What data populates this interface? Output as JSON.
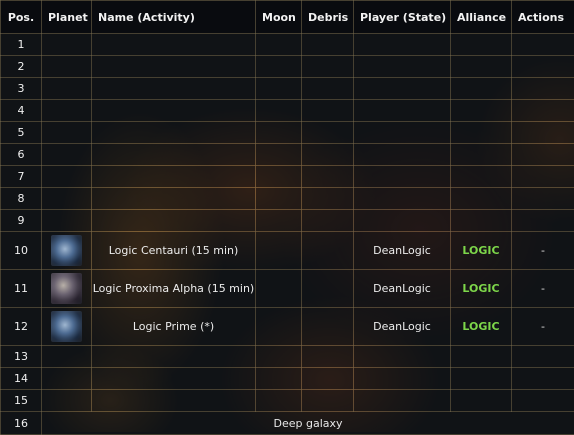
{
  "headers": {
    "pos": "Pos.",
    "planet": "Planet",
    "name": "Name (Activity)",
    "moon": "Moon",
    "debris": "Debris",
    "player": "Player (State)",
    "alliance": "Alliance",
    "actions": "Actions"
  },
  "rows": [
    {
      "pos": "1"
    },
    {
      "pos": "2"
    },
    {
      "pos": "3"
    },
    {
      "pos": "4"
    },
    {
      "pos": "5"
    },
    {
      "pos": "6"
    },
    {
      "pos": "7"
    },
    {
      "pos": "8"
    },
    {
      "pos": "9"
    },
    {
      "pos": "10",
      "planet_icon": "planet-blue-icon",
      "name": "Logic Centauri (15 min)",
      "player": "DeanLogic",
      "alliance": "LOGIC",
      "actions": "-"
    },
    {
      "pos": "11",
      "planet_icon": "planet-grey-icon",
      "name": "Logic Proxima Alpha (15 min)",
      "player": "DeanLogic",
      "alliance": "LOGIC",
      "actions": "-"
    },
    {
      "pos": "12",
      "planet_icon": "planet-blue-icon",
      "name": "Logic Prime (*)",
      "player": "DeanLogic",
      "alliance": "LOGIC",
      "actions": "-"
    },
    {
      "pos": "13"
    },
    {
      "pos": "14"
    },
    {
      "pos": "15"
    }
  ],
  "deep_row": {
    "pos": "16",
    "label": "Deep galaxy"
  },
  "colors": {
    "alliance": "#7dd64a",
    "border": "#786e50",
    "header_bg": "#0a0c10"
  }
}
